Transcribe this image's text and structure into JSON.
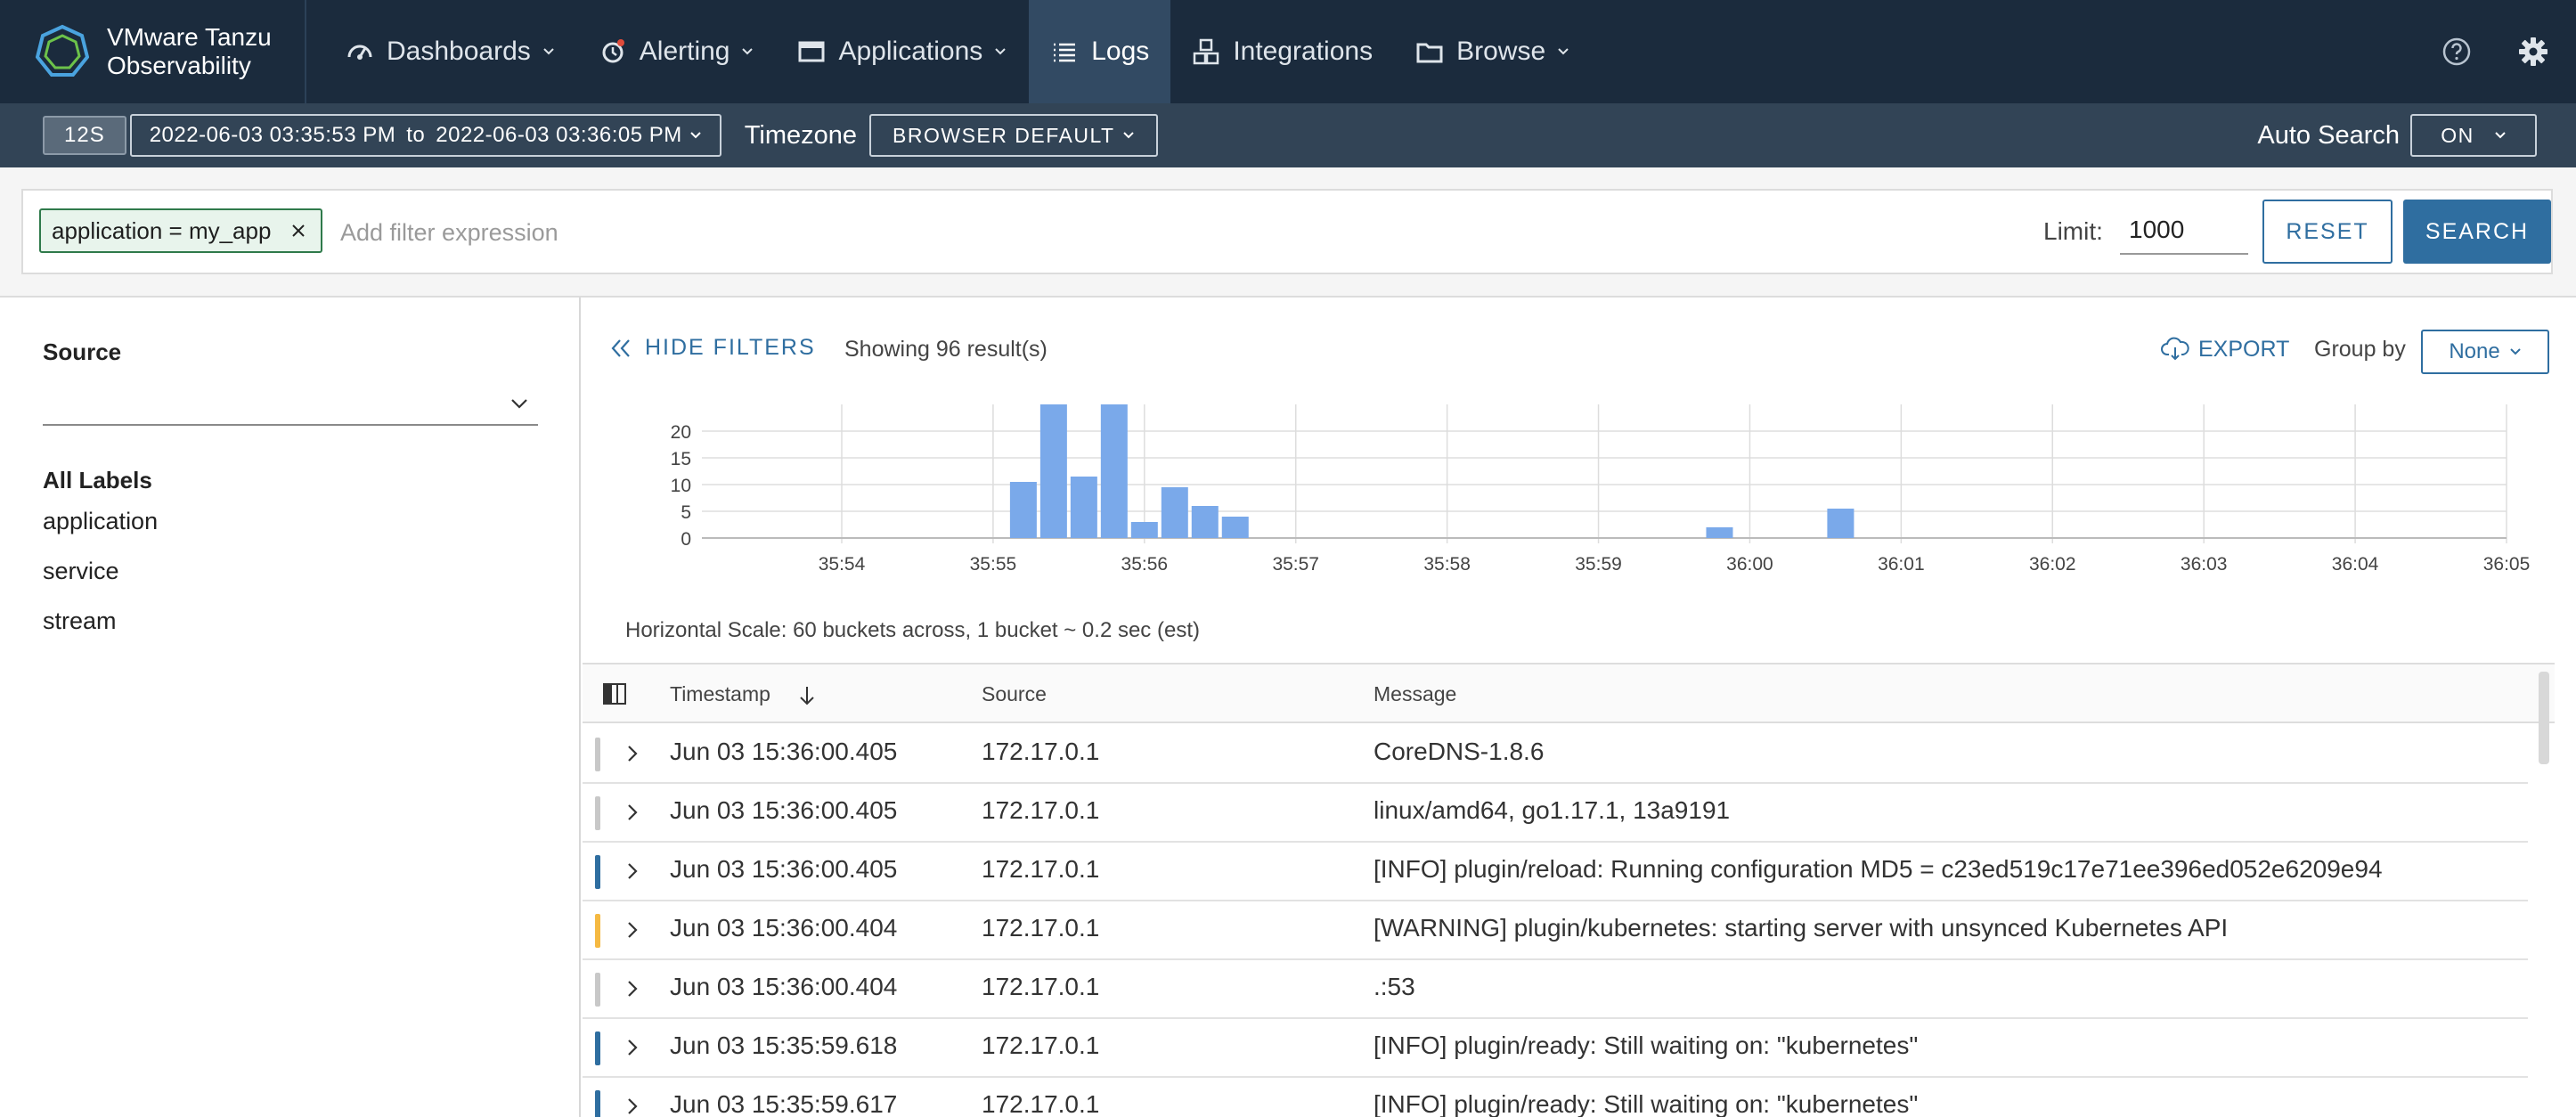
{
  "brand": {
    "line1": "VMware Tanzu",
    "line2": "Observability"
  },
  "nav": {
    "items": [
      {
        "label": "Dashboards",
        "icon": "dashboard-gauge-icon",
        "has_menu": true
      },
      {
        "label": "Alerting",
        "icon": "alarm-bell-icon",
        "has_menu": true
      },
      {
        "label": "Applications",
        "icon": "window-icon",
        "has_menu": true
      },
      {
        "label": "Logs",
        "icon": "list-icon",
        "has_menu": false,
        "active": true
      },
      {
        "label": "Integrations",
        "icon": "cubes-icon",
        "has_menu": false
      },
      {
        "label": "Browse",
        "icon": "folder-icon",
        "has_menu": true
      }
    ],
    "right_icons": [
      "help-circle-icon",
      "gear-icon"
    ]
  },
  "timebar": {
    "window": "12S",
    "from": "2022-06-03 03:35:53 PM",
    "to_word": "to",
    "to": "2022-06-03 03:36:05 PM",
    "timezone_label": "Timezone",
    "timezone_value": "BROWSER DEFAULT",
    "autosearch_label": "Auto Search",
    "autosearch_value": "ON"
  },
  "filter": {
    "chip": "application = my_app",
    "placeholder": "Add filter expression",
    "limit_label": "Limit:",
    "limit_value": "1000",
    "reset_label": "RESET",
    "search_label": "SEARCH"
  },
  "sidebar": {
    "source_title": "Source",
    "all_labels_title": "All Labels",
    "labels": [
      "application",
      "service",
      "stream"
    ]
  },
  "results": {
    "hide_filters": "HIDE FILTERS",
    "showing": "Showing 96 result(s)",
    "export": "EXPORT",
    "group_by_label": "Group by",
    "group_by_value": "None",
    "scale_note": "Horizontal Scale: 60 buckets across, 1 bucket ~ 0.2 sec (est)"
  },
  "chart_data": {
    "type": "bar",
    "yticks": [
      0,
      5,
      10,
      15,
      20
    ],
    "ylim": [
      0,
      25
    ],
    "xticks": [
      "35:54",
      "35:55",
      "35:56",
      "35:57",
      "35:58",
      "35:59",
      "36:00",
      "36:01",
      "36:02",
      "36:03",
      "36:04",
      "36:05"
    ],
    "bars": [
      {
        "time": "35:55.2",
        "value": 10.5
      },
      {
        "time": "35:55.4",
        "value": 25
      },
      {
        "time": "35:55.6",
        "value": 11.5
      },
      {
        "time": "35:55.8",
        "value": 25
      },
      {
        "time": "35:56.0",
        "value": 3
      },
      {
        "time": "35:56.2",
        "value": 9.5
      },
      {
        "time": "35:56.4",
        "value": 6
      },
      {
        "time": "35:56.6",
        "value": 4
      },
      {
        "time": "35:59.8",
        "value": 2
      },
      {
        "time": "36:00.6",
        "value": 5.5
      }
    ],
    "bar_color": "#7aa9ea",
    "grid": true
  },
  "table": {
    "columns": {
      "timestamp": "Timestamp",
      "source": "Source",
      "message": "Message"
    },
    "rows": [
      {
        "severity_color": "#c8c8c8",
        "timestamp": "Jun 03 15:36:00.405",
        "source": "172.17.0.1",
        "message": "CoreDNS-1.8.6"
      },
      {
        "severity_color": "#c8c8c8",
        "timestamp": "Jun 03 15:36:00.405",
        "source": "172.17.0.1",
        "message": "linux/amd64, go1.17.1, 13a9191"
      },
      {
        "severity_color": "#2f6ea0",
        "timestamp": "Jun 03 15:36:00.405",
        "source": "172.17.0.1",
        "message": "[INFO] plugin/reload: Running configuration MD5 = c23ed519c17e71ee396ed052e6209e94"
      },
      {
        "severity_color": "#f5b942",
        "timestamp": "Jun 03 15:36:00.404",
        "source": "172.17.0.1",
        "message": "[WARNING] plugin/kubernetes: starting server with unsynced Kubernetes API"
      },
      {
        "severity_color": "#c8c8c8",
        "timestamp": "Jun 03 15:36:00.404",
        "source": "172.17.0.1",
        "message": ".:53"
      },
      {
        "severity_color": "#2f6ea0",
        "timestamp": "Jun 03 15:35:59.618",
        "source": "172.17.0.1",
        "message": "[INFO] plugin/ready: Still waiting on: \"kubernetes\""
      },
      {
        "severity_color": "#2f6ea0",
        "timestamp": "Jun 03 15:35:59.617",
        "source": "172.17.0.1",
        "message": "[INFO] plugin/ready: Still waiting on: \"kubernetes\""
      }
    ]
  }
}
